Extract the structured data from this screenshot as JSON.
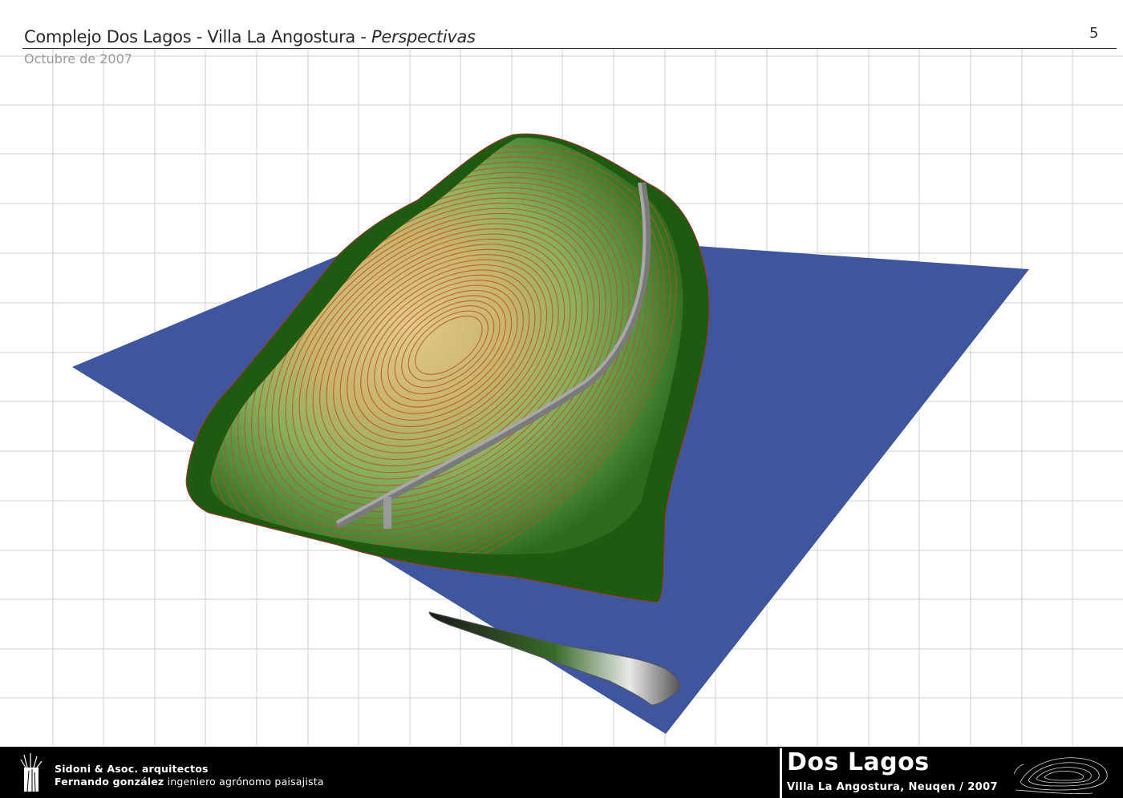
{
  "header": {
    "title_main": "Complejo Dos Lagos - Villa La Angostura - ",
    "title_italic": "Perspectivas",
    "date": "Octubre de 2007",
    "page_number": "5"
  },
  "footer": {
    "firm": "Sidoni & Asoc. arquitectos",
    "team_name": "Fernando gonzález",
    "team_role": " ingeniero agrónomo paisajista",
    "brand": "Dos Lagos",
    "location": "Villa La Angostura, Neuqen / 2007"
  },
  "colors": {
    "water": "#3f559e",
    "terrain_dark": "#1f5a10",
    "terrain_mid": "#5f9a48",
    "terrain_light": "#d8c98a",
    "contour": "#b4542a",
    "road": "#8f8f8f",
    "grid": "#cfcfcf"
  },
  "icons": {
    "logo": "grass-tuft-logo",
    "footer_map": "contour-map-thumbnail"
  }
}
